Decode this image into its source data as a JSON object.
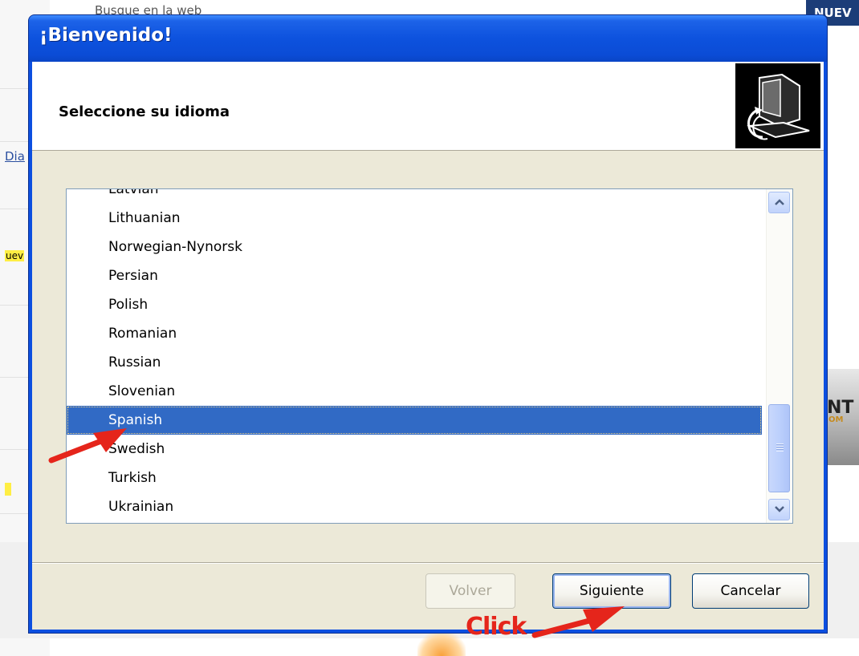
{
  "background": {
    "top_text": "Busque en la web",
    "left_link": "Dia",
    "left_highlight": "uev",
    "top_right_badge": "NUEV",
    "right_logo_line1": "NT",
    "right_logo_line2": "OM"
  },
  "dialog": {
    "title": "¡Bienvenido!",
    "header_title": "Seleccione su idioma",
    "header_icon": "computer-setup-icon",
    "languages": [
      "Latvian",
      "Lithuanian",
      "Norwegian-Nynorsk",
      "Persian",
      "Polish",
      "Romanian",
      "Russian",
      "Slovenian",
      "Spanish",
      "Swedish",
      "Turkish",
      "Ukrainian"
    ],
    "selected_language": "Spanish",
    "buttons": {
      "back": "Volver",
      "next": "Siguiente",
      "cancel": "Cancelar"
    }
  },
  "annotations": {
    "click_label": "Click",
    "arrow_color": "#e5251b"
  },
  "colors": {
    "titlebar": "#0b4cd6",
    "selection": "#316ac5",
    "dialog_body": "#ece9d8"
  }
}
